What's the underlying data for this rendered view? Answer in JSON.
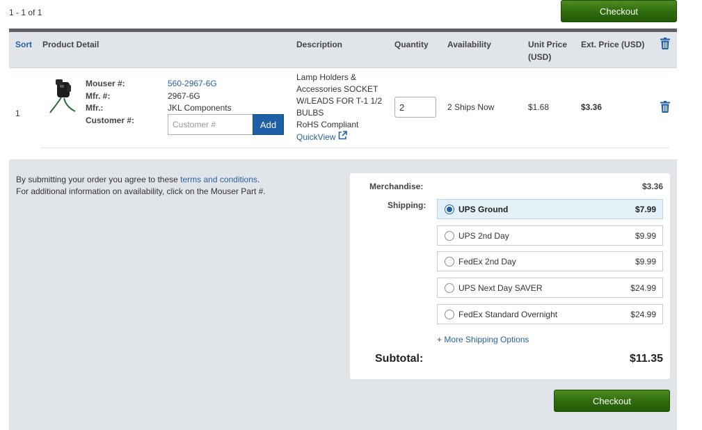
{
  "pagination": {
    "count_text": "1 - 1 of 1"
  },
  "checkout": {
    "label": "Checkout",
    "color": "#2f6a0d"
  },
  "table": {
    "headers": {
      "sort": "Sort",
      "product_detail": "Product Detail",
      "description": "Description",
      "quantity": "Quantity",
      "availability": "Availability",
      "unit_price": "Unit Price (USD)",
      "ext_price": "Ext. Price (USD)",
      "delete_icon": "trash-icon"
    },
    "rows": [
      {
        "index": "1",
        "image_icon": "lamp-holder-product-image",
        "labels": {
          "mouser": "Mouser #:",
          "mfr_num": "Mfr. #:",
          "mfr": "Mfr.:",
          "customer": "Customer #:"
        },
        "mouser_part": "560-2967-6G",
        "mfr_part": "2967-6G",
        "manufacturer": "JKL Components",
        "customer_placeholder": "Customer #",
        "add_label": "Add",
        "description": "Lamp Holders & Accessories SOCKET W/LEADS FOR T-1 1/2 BULBS",
        "rohs": "RoHS Compliant",
        "quickview": "QuickView",
        "quantity": "2",
        "availability": "2  Ships Now",
        "unit_price": "$1.68",
        "ext_price": "$3.36"
      }
    ]
  },
  "terms": {
    "line1_prefix": "By submitting your order you agree to these ",
    "line1_link": "terms and conditions",
    "line1_suffix": ".",
    "line2": "For additional information on availability, click on the Mouser Part #."
  },
  "summary": {
    "merchandise_label": "Merchandise:",
    "merchandise_value": "$3.36",
    "shipping_label": "Shipping:",
    "shipping_options": [
      {
        "name": "UPS Ground",
        "price": "$7.99",
        "selected": true
      },
      {
        "name": "UPS 2nd Day",
        "price": "$9.99",
        "selected": false
      },
      {
        "name": "FedEx 2nd Day",
        "price": "$9.99",
        "selected": false
      },
      {
        "name": "UPS Next Day SAVER",
        "price": "$24.99",
        "selected": false
      },
      {
        "name": "FedEx Standard Overnight",
        "price": "$24.99",
        "selected": false
      }
    ],
    "more_shipping": "+ More Shipping Options",
    "subtotal_label": "Subtotal:",
    "subtotal_value": "$11.35"
  },
  "colors": {
    "link": "#2a62a0",
    "header_bg": "#e1e4e8",
    "accent_blue": "#1f5fa5",
    "selected_ship_bg": "#e4f0f8"
  }
}
